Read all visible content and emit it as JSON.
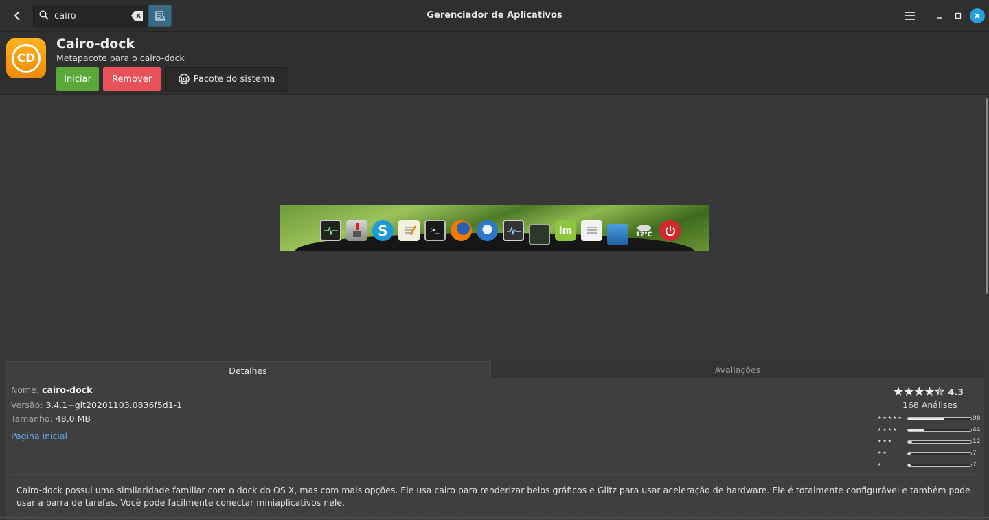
{
  "window": {
    "title": "Gerenciador de Aplicativos",
    "buttons": {
      "menu": "menu-icon",
      "minimize": "minimize-icon",
      "maximize": "maximize-icon",
      "close": "close-icon"
    }
  },
  "search": {
    "value": "cairo",
    "placeholder": ""
  },
  "app": {
    "name": "Cairo-dock",
    "summary": "Metapacote para o cairo-dock",
    "icon_text": "CD",
    "actions": {
      "launch": "Iniciar",
      "remove": "Remover",
      "source": "Pacote do sistema"
    }
  },
  "screenshot": {
    "dock_icons": [
      "system-monitor",
      "transmission",
      "skype",
      "text-editor",
      "terminal",
      "firefox",
      "thunderbird",
      "system-monitor-2",
      "network",
      "linux-mint",
      "notes",
      "trash",
      "weather",
      "power"
    ],
    "weather_text": "12°C"
  },
  "tabs": {
    "details": "Detalhes",
    "reviews": "Avaliações"
  },
  "details": {
    "name_label": "Nome:",
    "name_value": "cairo-dock",
    "version_label": "Versão:",
    "version_value": "3.4.1+git20201103.0836f5d1-1",
    "size_label": "Tamanho:",
    "size_value": "48,0 MB",
    "homepage": "Página inicial"
  },
  "rating": {
    "stars": "★★★★✯",
    "score": "4.3",
    "reviews": "168 Análises",
    "breakdown": [
      {
        "stars": "★★★★★",
        "count": "98",
        "fraction": 0.58
      },
      {
        "stars": "★★★★",
        "count": "44",
        "fraction": 0.26
      },
      {
        "stars": "★★★",
        "count": "12",
        "fraction": 0.07
      },
      {
        "stars": "★★",
        "count": "7",
        "fraction": 0.02
      },
      {
        "stars": "★",
        "count": "7",
        "fraction": 0.02
      }
    ]
  },
  "description": "Cairo-dock possui uma similaridade familiar com o dock do OS X, mas com mais opções. Ele usa cairo para renderizar belos gráficos e Glitz para usar aceleração de hardware. Ele é totalmente configurável e também pode usar a barra de tarefas. Você pode facilmente conectar miniaplicativos nele."
}
